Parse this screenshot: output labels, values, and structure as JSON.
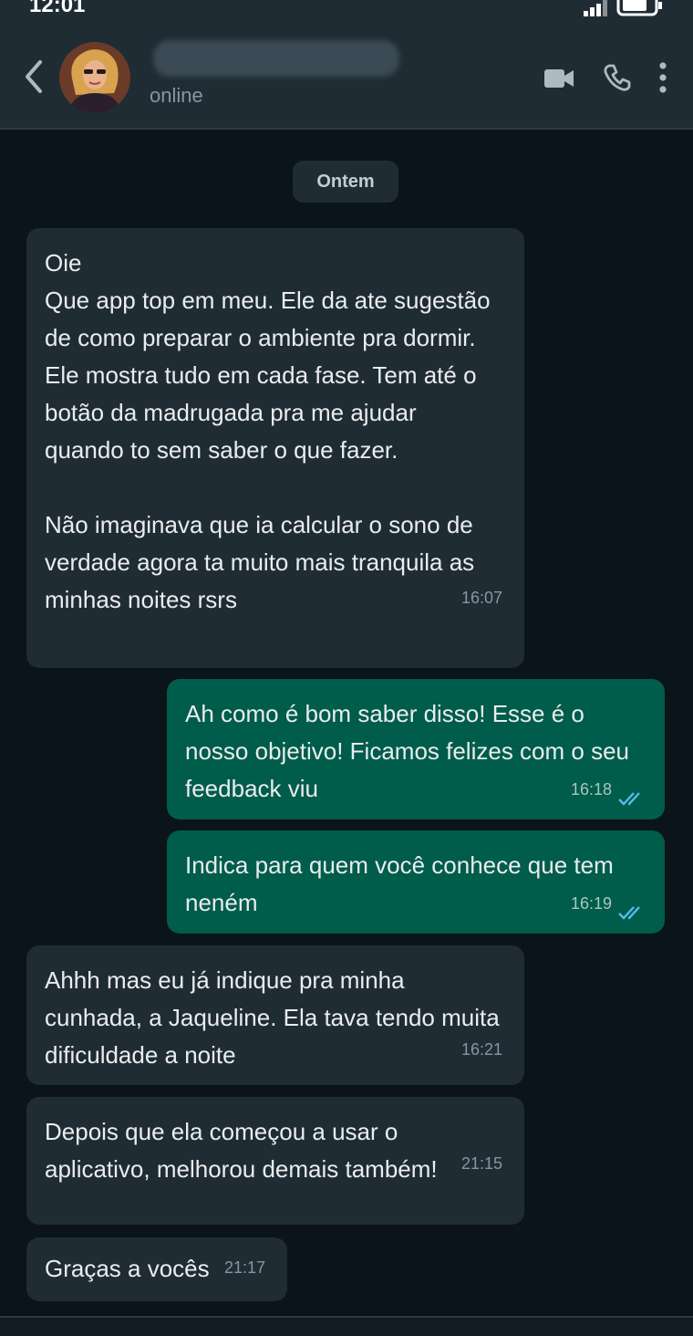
{
  "status_bar": {
    "time": "12:01"
  },
  "header": {
    "status": "online"
  },
  "date_chip": "Ontem",
  "messages": [
    {
      "direction": "in",
      "text": "Oie\nQue app top em meu. Ele da ate sugestão\nde como preparar o ambiente pra dormir.\nEle mostra tudo em cada fase. Tem até o\nbotão da madrugada pra me ajudar\nquando to sem saber o que fazer.\n\nNão imaginava que ia calcular o sono de\nverdade agora ta muito mais tranquila as\nminhas noites rsrs",
      "time": "16:07"
    },
    {
      "direction": "out",
      "text": "Ah como é bom saber disso! Esse é o\nnosso objetivo! Ficamos felizes com o seu\nfeedback viu",
      "time": "16:18",
      "status": "read"
    },
    {
      "direction": "out",
      "text": "Indica para quem você conhece que tem\nneném",
      "time": "16:19",
      "status": "read"
    },
    {
      "direction": "in",
      "text": "Ahhh mas eu já indique pra minha\ncunhada, a Jaqueline. Ela tava tendo muita\ndificuldade a noite",
      "time": "16:21"
    },
    {
      "direction": "in",
      "text": "Depois que ela começou a usar o\naplicativo, melhorou demais também!",
      "time": "21:15"
    },
    {
      "direction": "in",
      "text": "Graças a vocês",
      "time": "21:17"
    }
  ],
  "colors": {
    "background": "#0b141a",
    "header": "#1f2c34",
    "incoming_bubble": "#202c33",
    "outgoing_bubble": "#005c4b",
    "read_ticks": "#53bdeb"
  },
  "icons": [
    "back-icon",
    "video-call-icon",
    "voice-call-icon",
    "more-options-icon",
    "signal-icon",
    "battery-icon",
    "read-ticks-icon"
  ]
}
